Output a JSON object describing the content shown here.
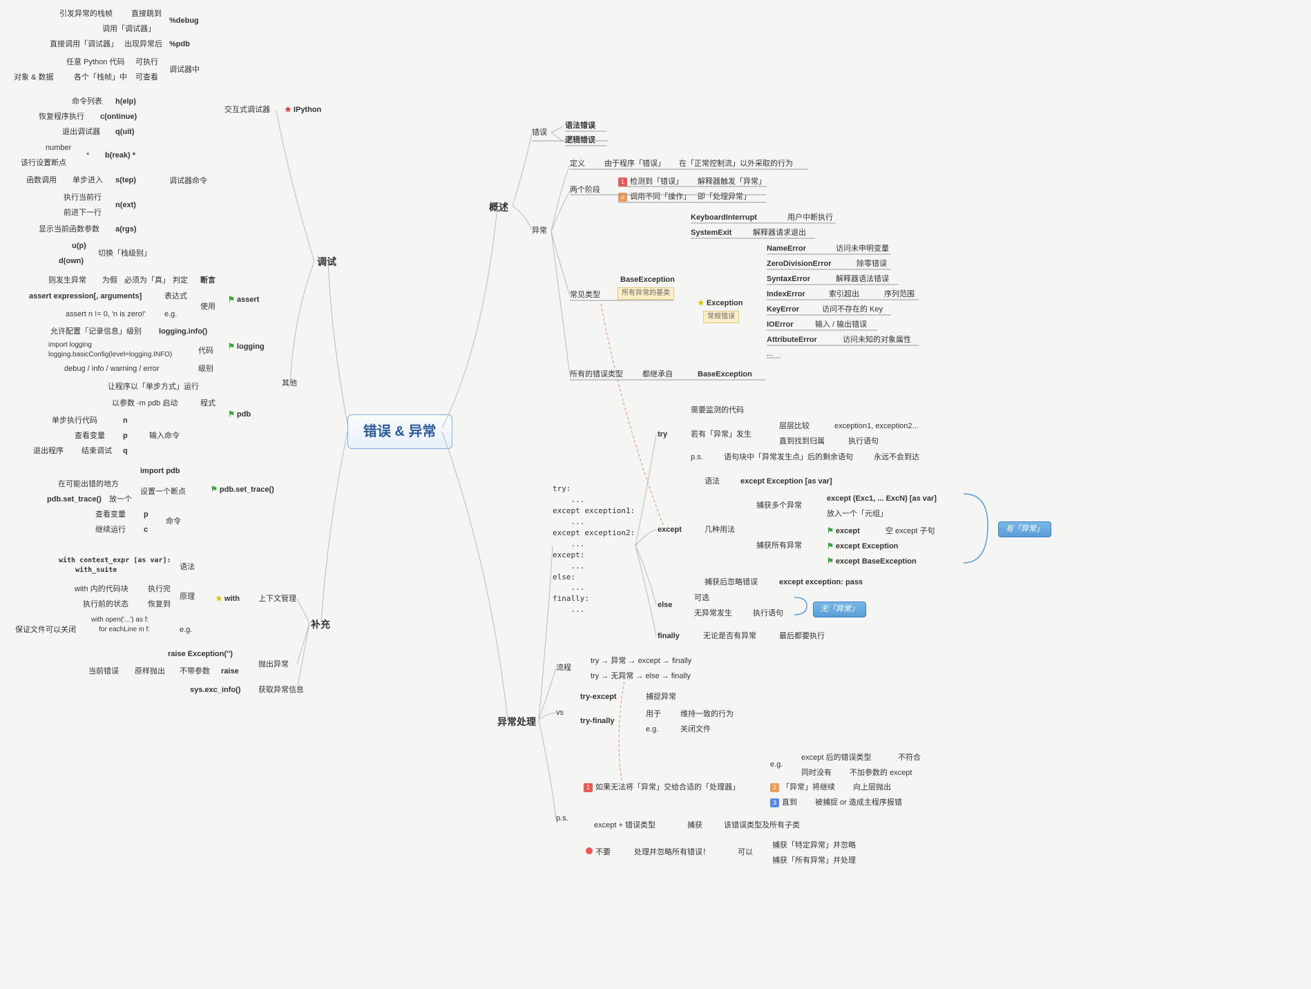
{
  "root": "错误 & 异常",
  "main": {
    "overview": "概述",
    "handling": "异常处理",
    "debug": "调试",
    "supplement": "补充"
  },
  "overview": {
    "error": "错误",
    "syntax_err": "语法错误",
    "logic_err": "逻辑错误",
    "exception": "异常",
    "definition": "定义",
    "def_a": "由于程序「错误」",
    "def_b": "在「正常控制流」以外采取的行为",
    "two_phase": "两个阶段",
    "phase1a": "检测到「错误」",
    "phase1b": "解释器触发「异常」",
    "phase2a": "调用不同「操作」",
    "phase2b": "即「处理异常」",
    "common_types": "常见类型",
    "base_exc": "BaseException",
    "base_note": "所有异常的基类",
    "ki": "KeyboardInterrupt",
    "ki_d": "用户中断执行",
    "se": "SystemExit",
    "se_d": "解释器请求退出",
    "exc": "Exception",
    "exc_note": "常规错误",
    "ne": "NameError",
    "ne_d": "访问未申明变量",
    "zde": "ZeroDivisionError",
    "zde_d": "除零错误",
    "sxe": "SyntaxError",
    "sxe_d": "解释器语法错误",
    "ie": "IndexError",
    "ie_d": "索引超出",
    "ie_d2": "序列范围",
    "ke": "KeyError",
    "ke_d": "访问不存在的 Key",
    "ioe": "IOError",
    "ioe_d": "输入 / 输出错误",
    "ae": "AttributeError",
    "ae_d": "访问未知的对象属性",
    "dots": "...",
    "all_types": "所有的错误类型",
    "inherit": "都继承自",
    "base2": "BaseException"
  },
  "handling": {
    "code_block": "try:\n    ...\nexcept exception1:\n    ...\nexcept exception2:\n    ...\nexcept:\n    ...\nelse:\n    ...\nfinally:\n    ...",
    "try": "try",
    "try_a": "需要监测的代码",
    "try_b": "若有「异常」发生",
    "try_b1": "层层比较",
    "try_b1d": "exception1, exception2...",
    "try_b2": "直到找到归属",
    "try_b2d": "执行语句",
    "try_ps": "p.s.",
    "try_ps_a": "语句块中「异常发生点」后的剩余语句",
    "try_ps_b": "永远不会到达",
    "except": "except",
    "except_a": "语法",
    "except_a1": "except Exception [as var]",
    "except_b": "几种用法",
    "except_b1": "捕获多个异常",
    "except_b1a": "except (Exc1, ... ExcN) [as var]",
    "except_b1b": "放入一个「元组」",
    "except_b2": "捕获所有异常",
    "except_b2a": "except",
    "except_b2a_d": "空 except 子句",
    "except_b2b": "except Exception",
    "except_b2c": "except BaseException",
    "except_c": "捕获后忽略错误",
    "except_c1": "except exception: pass",
    "else": "else",
    "else_a": "可选",
    "else_b": "无异常发生",
    "else_b1": "执行语句",
    "finally": "finally",
    "finally_a": "无论是否有异常",
    "finally_b": "最后都要执行",
    "flow": "流程",
    "flow1": "try → 异常 → except → finally",
    "flow2": "try → 无异常 → else → finally",
    "vs": "vs",
    "vs1": "try-except",
    "vs1a": "捕捉异常",
    "vs2": "try-finally",
    "vs2a": "用于",
    "vs2b": "维持一致的行为",
    "vs2c": "e.g.",
    "vs2d": "关闭文件",
    "ps": "p.s.",
    "ps1": "如果无法将「异常」交给合适的「处理器」",
    "ps1_eg": "e.g.",
    "ps1_eg1": "except 后的错误类型",
    "ps1_eg1d": "不符合",
    "ps1_eg2": "同时没有",
    "ps1_eg2d": "不加参数的 except",
    "ps1_2": "「异常」将继续",
    "ps1_2d": "向上层抛出",
    "ps1_3": "直到",
    "ps1_3d": "被捕捉 or 造成主程序报错",
    "ps2": "except + 错误类型",
    "ps2a": "捕获",
    "ps2b": "该错误类型及所有子类",
    "ps3": "不要",
    "ps3a": "处理并忽略所有错误！",
    "ps3b": "可以",
    "ps3c1": "捕获「特定异常」并忽略",
    "ps3c2": "捕获「所有异常」并处理",
    "badge_has": "有「异常」",
    "badge_no": "无「异常」"
  },
  "debug": {
    "interactive": "交互式调试器",
    "ipy": "IPython",
    "pdebug": "%debug",
    "pd1": "引发异常的栈帧",
    "pd1d": "直接跳到",
    "pd2": "调用「调试器」",
    "ppdb": "%pdb",
    "pp1": "直接调用「调试器」",
    "pp2": "出现异常后",
    "inside": "调试器中",
    "ins1": "任意 Python 代码",
    "ins1d": "可执行",
    "ins2a": "对象 & 数据",
    "ins2b": "各个「栈帧」中",
    "ins2c": "可查看",
    "cmds": "调试器命令",
    "c_help": "h(elp)",
    "c_help_d": "命令列表",
    "c_cont": "c(ontinue)",
    "c_cont_d": "恢复程序执行",
    "c_quit": "q(uit)",
    "c_quit_d": "退出调试器",
    "c_break": "b(reak) *",
    "c_break_a": "*",
    "c_break_a1": "number",
    "c_break_a2": "该行设置断点",
    "c_step": "s(tep)",
    "c_step_a": "函数调用",
    "c_step_b": "单步进入",
    "c_next": "n(ext)",
    "c_next_a": "执行当前行",
    "c_next_b": "前进下一行",
    "c_args": "a(rgs)",
    "c_args_d": "显示当前函数参数",
    "c_switch": "切换「栈级别」",
    "c_up": "u(p)",
    "c_down": "d(own)",
    "other": "其他",
    "assert": "assert",
    "assert_h": "断言",
    "as_judge": "判定",
    "as_j1": "为假",
    "as_j1d": "则发生异常",
    "as_j2": "必须为「真」",
    "as_use": "使用",
    "as_expr": "表达式",
    "as_expr1": "assert expression[, arguments]",
    "as_eg": "e.g.",
    "as_eg1": "assert n != 0, 'n is zero!'",
    "logging": "logging",
    "log_info": "logging.info()",
    "log_info_d": "允许配置「记录信息」级别",
    "log_code": "代码",
    "log_code1": "import logging\nlogging.basicConfig(level=logging.INFO)",
    "log_level": "级别",
    "log_level1": "debug / info / warning / error",
    "pdb_m": "pdb",
    "pdb_d": "让程序以「单步方式」运行",
    "pdb_mode": "程式",
    "pdb_mode1": "以参数 -m pdb 启动",
    "pdb_in": "输入命令",
    "pdb_in1": "单步执行代码",
    "pdb_in1d": "n",
    "pdb_in2": "查看变量",
    "pdb_in2d": "p",
    "pdb_in3": "退出程序",
    "pdb_in3d": "结束调试",
    "pdb_in3e": "q",
    "pst": "pdb.set_trace()",
    "pst_imp": "import pdb",
    "pst_set": "设置一个断点",
    "pst_set1": "在可能出错的地方",
    "pst_set2": "pdb.set_trace()",
    "pst_set2d": "放一个",
    "pst_cmd": "命令",
    "pst_c1": "查看变量",
    "pst_c1d": "p",
    "pst_c2": "继续运行",
    "pst_c2d": "c"
  },
  "supplement": {
    "ctx": "上下文管理",
    "with": "with",
    "w_syntax": "语法",
    "w_syntax1": "with context_expr [as var]:\n    with_suite",
    "w_prin": "原理",
    "w_p1": "with 内的代码块",
    "w_p1d": "执行完",
    "w_p2": "执行前的状态",
    "w_p2d": "恢复到",
    "w_eg": "e.g.",
    "w_eg1": "with open('...') as f:\n    for eachLine in f:",
    "w_eg2": "保证文件可以关闭",
    "raise_t": "抛出异常",
    "raise_e": "raise Exception('')",
    "raise": "raise",
    "raise_a": "不带参数",
    "raise_b": "当前错误",
    "raise_c": "原样抛出",
    "exc_info": "sys.exc_info()",
    "exc_info_d": "获取异常信息"
  }
}
